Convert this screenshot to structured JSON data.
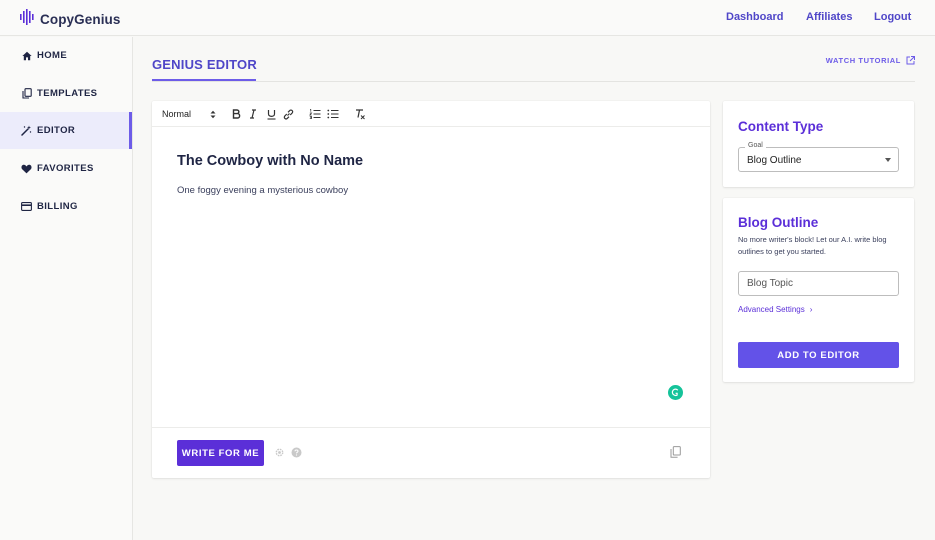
{
  "app": {
    "name": "CopyGenius",
    "logo_icon": "waveform-logo-icon",
    "accent": "#5b2fd8"
  },
  "topnav": {
    "dashboard": "Dashboard",
    "affiliates": "Affiliates",
    "logout": "Logout"
  },
  "sidebar": {
    "items": [
      {
        "label": "HOME",
        "icon": "home-icon"
      },
      {
        "label": "TEMPLATES",
        "icon": "copy-icon"
      },
      {
        "label": "EDITOR",
        "icon": "magic-wand-icon",
        "active": true
      },
      {
        "label": "FAVORITES",
        "icon": "heart-icon"
      },
      {
        "label": "BILLING",
        "icon": "credit-card-icon"
      }
    ]
  },
  "header": {
    "title": "GENIUS EDITOR",
    "watch_tutorial": "WATCH TUTORIAL"
  },
  "editor": {
    "format_select": "Normal",
    "toolbar_icons": [
      "bold-icon",
      "italic-icon",
      "underline-icon",
      "link-icon",
      "ordered-list-icon",
      "bullet-list-icon",
      "clear-format-icon"
    ],
    "document_title": "The Cowboy with No Name",
    "document_body": "One foggy evening a mysterious cowboy",
    "write_button": "WRITE FOR ME"
  },
  "content_type": {
    "title": "Content Type",
    "goal_label": "Goal",
    "goal_value": "Blog Outline"
  },
  "blog_outline": {
    "title": "Blog Outline",
    "description": "No more writer's block! Let our A.I. write blog outlines to get you started.",
    "topic_placeholder": "Blog Topic",
    "advanced_settings": "Advanced Settings",
    "add_button": "ADD TO EDITOR"
  }
}
